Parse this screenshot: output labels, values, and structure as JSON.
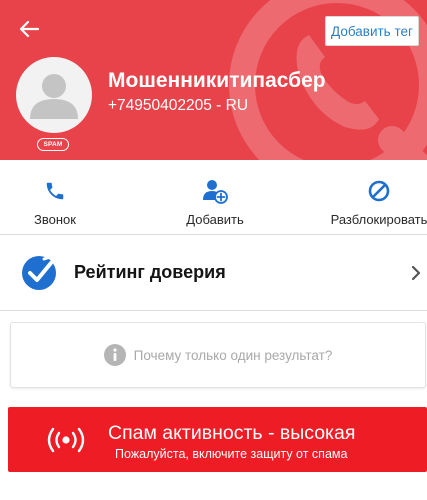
{
  "header": {
    "back_icon": "arrow-left-icon",
    "add_tag_label": "Добавить тег",
    "contact_name": "Мошенникитипасбер",
    "phone_line": "+74950402205 - RU",
    "spam_badge": "SPAM",
    "avatar_icon": "person-icon",
    "watermark_icon": "phone-logo-icon",
    "background_color": "#e8434a"
  },
  "actions": [
    {
      "label": "Звонок",
      "icon": "phone-icon"
    },
    {
      "label": "Добавить",
      "icon": "add-person-icon"
    },
    {
      "label": "Разблокировать",
      "icon": "block-icon"
    }
  ],
  "trust": {
    "title": "Рейтинг доверия",
    "icon": "shield-check-icon",
    "chevron_icon": "chevron-right-icon"
  },
  "info": {
    "text": "Почему только один результат?",
    "icon": "info-icon"
  },
  "spam_banner": {
    "title": "Спам активность - высокая",
    "subtitle": "Пожалуйста, включите защиту от спама",
    "icon": "broadcast-icon",
    "background_color": "#ee1c25"
  },
  "accent_color": "#1f6fd0"
}
